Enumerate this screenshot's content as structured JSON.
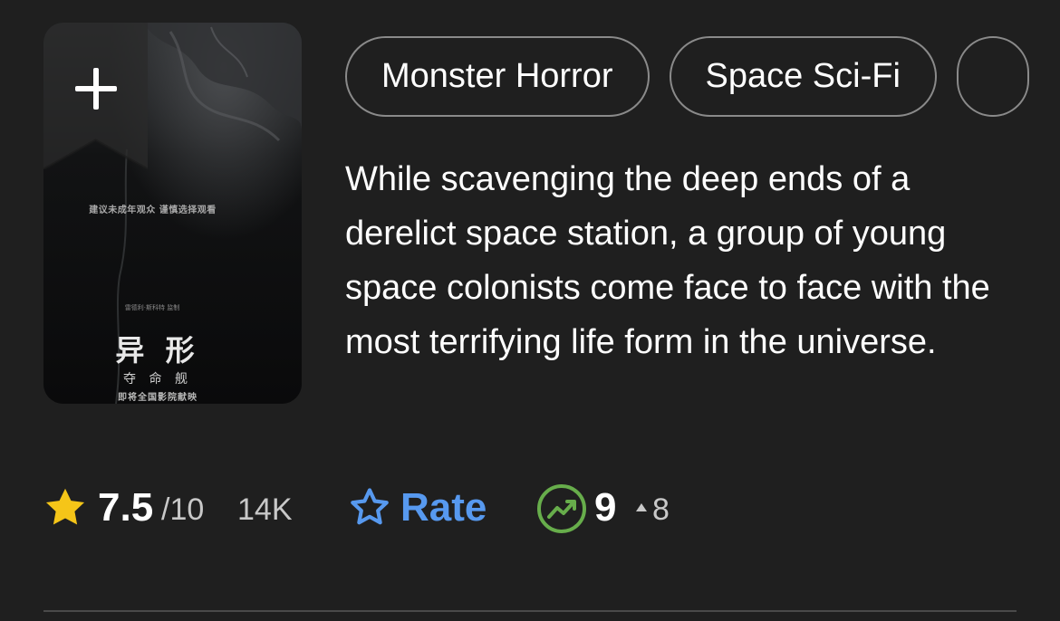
{
  "poster": {
    "tagline": "建议未成年观众 谨慎选择观看",
    "credits": "雷德利·斯科特 监制",
    "title": "异 形",
    "subtitle": "夺 命 舰",
    "release": "即将全国影院献映"
  },
  "genres": [
    "Monster Horror",
    "Space Sci-Fi",
    ""
  ],
  "description": "While scavenging the deep ends of a derelict space station, a group of young space colonists come face to face with the most terrifying life form in the universe.",
  "rating": {
    "value": "7.5",
    "scale": "/10",
    "count": "14K"
  },
  "rate": {
    "label": "Rate"
  },
  "popularity": {
    "rank": "9",
    "change": "8"
  },
  "colors": {
    "background": "#1f1f1f",
    "star": "#f5c518",
    "rate_blue": "#5799ef",
    "trend_green": "#67ad4b"
  }
}
